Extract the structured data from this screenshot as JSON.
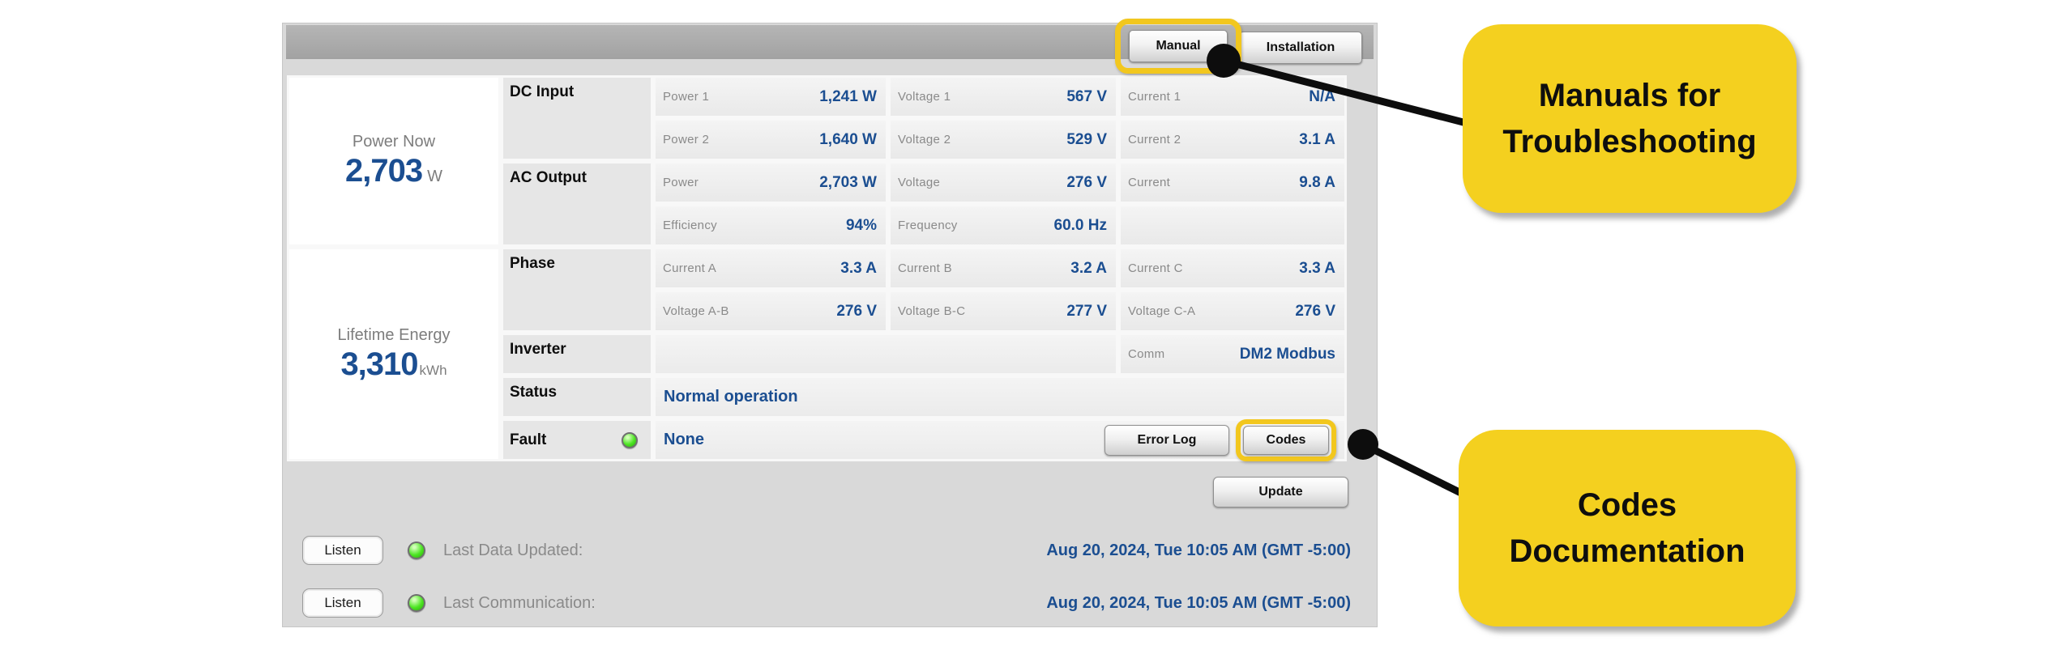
{
  "header": {
    "manual_button": "Manual",
    "installation_button": "Installation"
  },
  "summary": {
    "power_now_label": "Power Now",
    "power_now_value": "2,703",
    "power_now_unit": "W",
    "lifetime_label": "Lifetime Energy",
    "lifetime_value": "3,310",
    "lifetime_unit": "kWh"
  },
  "sections": {
    "dc_input": "DC Input",
    "ac_output": "AC Output",
    "phase": "Phase",
    "inverter": "Inverter",
    "status": "Status",
    "fault": "Fault"
  },
  "cells": {
    "power1": {
      "label": "Power 1",
      "value": "1,241 W"
    },
    "voltage1": {
      "label": "Voltage 1",
      "value": "567 V"
    },
    "current1": {
      "label": "Current 1",
      "value": "N/A"
    },
    "power2": {
      "label": "Power 2",
      "value": "1,640 W"
    },
    "voltage2": {
      "label": "Voltage 2",
      "value": "529 V"
    },
    "current2": {
      "label": "Current 2",
      "value": "3.1 A"
    },
    "ac_power": {
      "label": "Power",
      "value": "2,703 W"
    },
    "ac_voltage": {
      "label": "Voltage",
      "value": "276 V"
    },
    "ac_current": {
      "label": "Current",
      "value": "9.8 A"
    },
    "efficiency": {
      "label": "Efficiency",
      "value": "94%"
    },
    "frequency": {
      "label": "Frequency",
      "value": "60.0 Hz"
    },
    "current_a": {
      "label": "Current A",
      "value": "3.3 A"
    },
    "current_b": {
      "label": "Current B",
      "value": "3.2 A"
    },
    "current_c": {
      "label": "Current C",
      "value": "3.3 A"
    },
    "voltage_ab": {
      "label": "Voltage A-B",
      "value": "276 V"
    },
    "voltage_bc": {
      "label": "Voltage B-C",
      "value": "277 V"
    },
    "voltage_ca": {
      "label": "Voltage C-A",
      "value": "276 V"
    },
    "comm": {
      "label": "Comm",
      "value": "DM2 Modbus"
    }
  },
  "status_value": "Normal operation",
  "fault_value": "None",
  "buttons": {
    "error_log": "Error Log",
    "codes": "Codes",
    "update": "Update",
    "listen": "Listen"
  },
  "footer": {
    "last_data_label": "Last Data Updated:",
    "last_data_value": "Aug 20, 2024, Tue 10:05 AM (GMT -5:00)",
    "last_comm_label": "Last Communication:",
    "last_comm_value": "Aug 20, 2024, Tue 10:05 AM (GMT -5:00)"
  },
  "annotations": {
    "manual_note_line1": "Manuals for",
    "manual_note_line2": "Troubleshooting",
    "codes_note_line1": "Codes",
    "codes_note_line2": "Documentation"
  },
  "colors": {
    "highlight_yellow": "#F2C71E",
    "callout_yellow": "#F4D01F",
    "value_navy": "#1B4E91",
    "led_green": "#4CE522",
    "panel_gray": "#D9D9D9",
    "topbar_gray": "#A9A9A9",
    "connector_black": "#0D0D0D"
  }
}
